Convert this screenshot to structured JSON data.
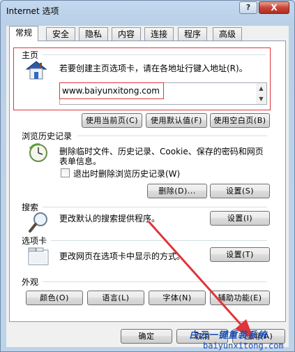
{
  "window": {
    "title": "Internet 选项",
    "help": "?",
    "close": "X"
  },
  "tabs": [
    "常规",
    "安全",
    "隐私",
    "内容",
    "连接",
    "程序",
    "高级"
  ],
  "homepage": {
    "group_title": "主页",
    "description": "若要创建主页选项卡，请在各地址行键入地址(R)。",
    "url": "www.baiyunxitong.com",
    "buttons": [
      "使用当前页(C)",
      "使用默认值(F)",
      "使用空白页(B)"
    ]
  },
  "history": {
    "group_title": "浏览历史记录",
    "description_line1": "删除临时文件、历史记录、Cookie、保存的密码和网页",
    "description_line2": "表单信息。",
    "checkbox_label": "退出时删除浏览历史记录(W)",
    "delete_button": "删除(D)...",
    "settings_button": "设置(S)"
  },
  "search": {
    "group_title": "搜索",
    "description": "更改默认的搜索提供程序。",
    "settings_button": "设置(I)"
  },
  "tabsection": {
    "group_title": "选项卡",
    "description": "更改网页在选项卡中显示的方式。",
    "settings_button": "设置(T)"
  },
  "appearance": {
    "group_title": "外观",
    "buttons": [
      "颜色(O)",
      "语言(L)",
      "字体(N)",
      "辅助功能(E)"
    ]
  },
  "footer": {
    "ok": "确定",
    "cancel": "取消",
    "apply": "应用(A)"
  },
  "watermark": {
    "line1": "白云一键重装系统",
    "line2": "baiyunxitong.com"
  },
  "colors": {
    "annotation_red": "#e0343a",
    "titlebar": "#c4d9ee",
    "close": "#c7463a"
  },
  "icons": [
    "house-icon",
    "globe-clock-icon",
    "magnifier-icon",
    "tabs-window-icon"
  ]
}
